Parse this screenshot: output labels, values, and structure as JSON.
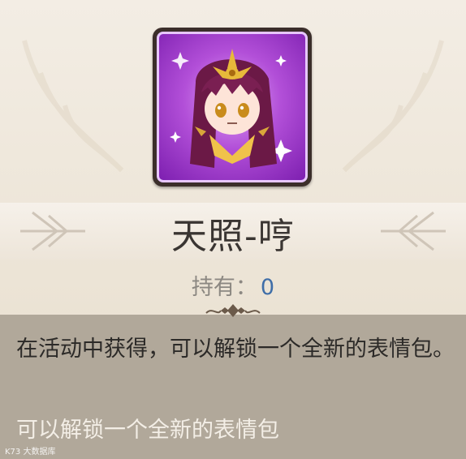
{
  "item": {
    "name": "天照-哼",
    "owned_label": "持有：",
    "owned_count": "0",
    "icon": "chibi-character-portrait-icon",
    "rarity_color": "#9b3fd0"
  },
  "description": {
    "main": "在活动中获得，可以解锁一个全新的表情包。",
    "sub": "可以解锁一个全新的表情包"
  },
  "watermark": "K73 大数据库"
}
